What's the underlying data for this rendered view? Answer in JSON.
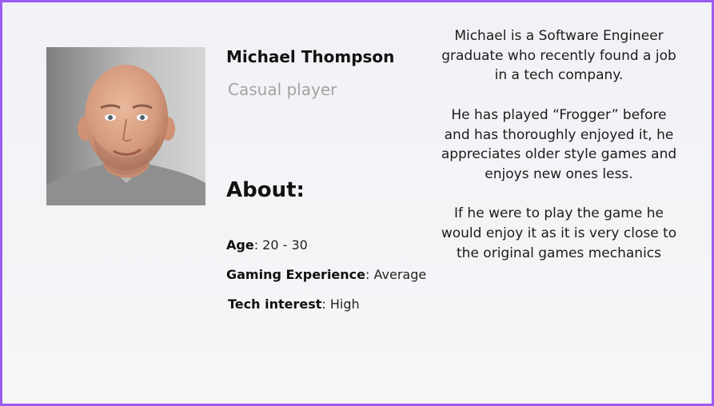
{
  "persona": {
    "name": "Michael Thompson",
    "role": "Casual player",
    "about_heading": "About:",
    "attributes": [
      {
        "label": "Age",
        "separator": ":",
        "value": " 20 - 30"
      },
      {
        "label": "Gaming Experience",
        "separator": ":",
        "value": " Average"
      },
      {
        "label": "Tech interest",
        "separator": ":",
        "value": " High"
      }
    ],
    "bio": [
      "Michael is a Software Engineer graduate who recently found a job in a tech company.",
      "He has played “Frogger” before and has thoroughly enjoyed it, he appreciates older style games and enjoys new ones less.",
      "If he were to play the game he would enjoy it as it is very close to the original games mechanics"
    ]
  },
  "colors": {
    "border": "#9b5cf0",
    "role_text": "#a3a3a3"
  }
}
